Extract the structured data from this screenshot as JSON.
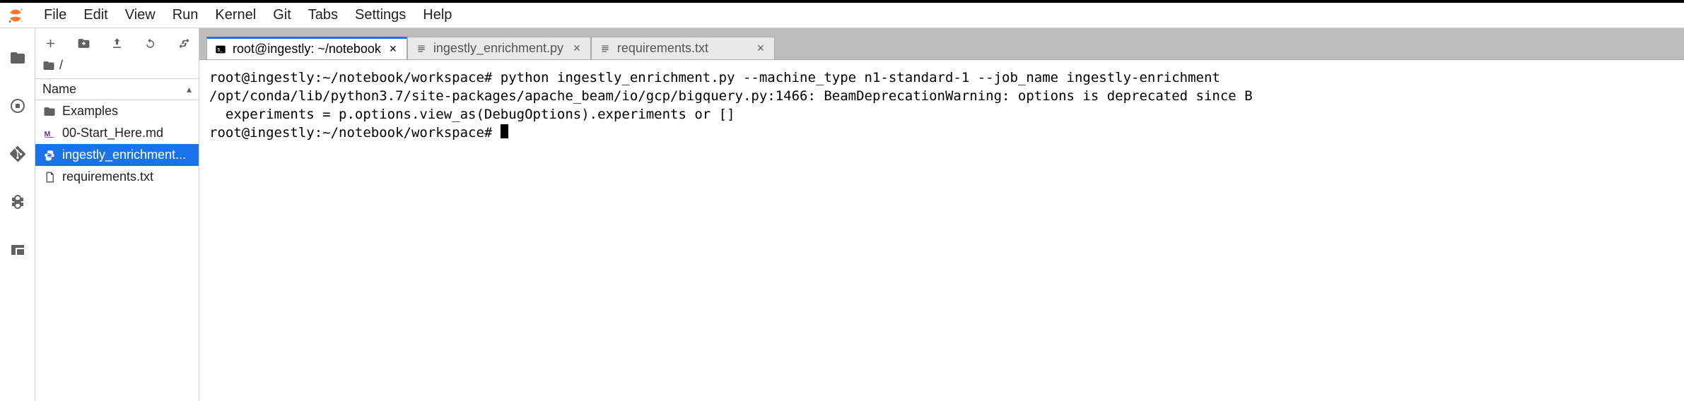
{
  "menu": {
    "items": [
      "File",
      "Edit",
      "View",
      "Run",
      "Kernel",
      "Git",
      "Tabs",
      "Settings",
      "Help"
    ]
  },
  "filebrowser": {
    "path": "/",
    "header": {
      "name_col": "Name"
    },
    "items": [
      {
        "kind": "folder",
        "label": "Examples"
      },
      {
        "kind": "markdown",
        "label": "00-Start_Here.md"
      },
      {
        "kind": "python",
        "label": "ingestly_enrichment...",
        "selected": true
      },
      {
        "kind": "text",
        "label": "requirements.txt"
      }
    ]
  },
  "tabs": [
    {
      "kind": "terminal",
      "label": "root@ingestly: ~/notebook",
      "active": true
    },
    {
      "kind": "editor",
      "label": "ingestly_enrichment.py",
      "active": false
    },
    {
      "kind": "editor",
      "label": "requirements.txt",
      "active": false
    }
  ],
  "terminal": {
    "lines": [
      "root@ingestly:~/notebook/workspace# python ingestly_enrichment.py --machine_type n1-standard-1 --job_name ingestly-enrichment",
      "/opt/conda/lib/python3.7/site-packages/apache_beam/io/gcp/bigquery.py:1466: BeamDeprecationWarning: options is deprecated since B",
      "  experiments = p.options.view_as(DebugOptions).experiments or []"
    ],
    "prompt": "root@ingestly:~/notebook/workspace# "
  }
}
